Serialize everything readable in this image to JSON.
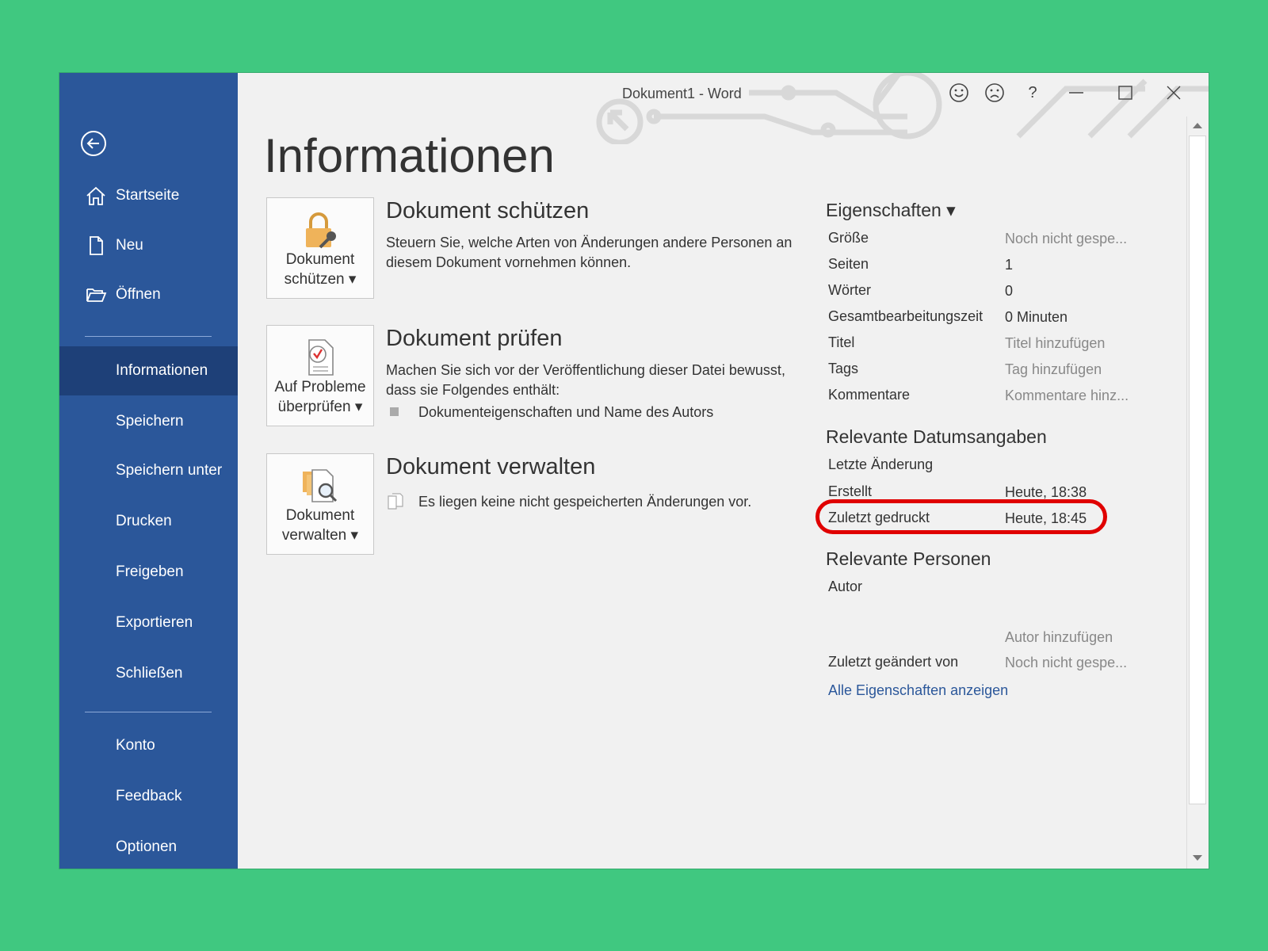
{
  "window": {
    "title": "Dokument1  -  Word",
    "help": "?"
  },
  "sidebar": {
    "items": [
      {
        "label": "Startseite"
      },
      {
        "label": "Neu"
      },
      {
        "label": "Öffnen"
      },
      {
        "label": "Informationen"
      },
      {
        "label": "Speichern"
      },
      {
        "label": "Speichern unter"
      },
      {
        "label": "Drucken"
      },
      {
        "label": "Freigeben"
      },
      {
        "label": "Exportieren"
      },
      {
        "label": "Schließen"
      },
      {
        "label": "Konto"
      },
      {
        "label": "Feedback"
      },
      {
        "label": "Optionen"
      }
    ],
    "active": "Informationen"
  },
  "main": {
    "title": "Informationen",
    "sections": [
      {
        "button": "Dokument\nschützen ▾",
        "title": "Dokument schützen",
        "text": "Steuern Sie, welche Arten von Änderungen andere Personen an diesem Dokument vornehmen können."
      },
      {
        "button": "Auf Probleme\nüberprüfen ▾",
        "title": "Dokument prüfen",
        "text": "Machen Sie sich vor der Veröffentlichung dieser Datei bewusst, dass sie Folgendes enthält:",
        "bullet": "Dokumenteigenschaften und Name des Autors"
      },
      {
        "button": "Dokument\nverwalten ▾",
        "title": "Dokument verwalten",
        "text": "Es liegen keine nicht gespeicherten Änderungen vor."
      }
    ]
  },
  "properties": {
    "header": "Eigenschaften ▾",
    "rows": [
      {
        "label": "Größe",
        "value": "Noch nicht gespe..."
      },
      {
        "label": "Seiten",
        "value": "1"
      },
      {
        "label": "Wörter",
        "value": "0"
      },
      {
        "label": "Gesamtbearbeitungszeit",
        "value": "0 Minuten"
      },
      {
        "label": "Titel",
        "value": "Titel hinzufügen"
      },
      {
        "label": "Tags",
        "value": "Tag hinzufügen"
      },
      {
        "label": "Kommentare",
        "value": "Kommentare hinz..."
      }
    ],
    "dates_header": "Relevante Datumsangaben",
    "dates": [
      {
        "label": "Letzte Änderung",
        "value": ""
      },
      {
        "label": "Erstellt",
        "value": "Heute, 18:38"
      },
      {
        "label": "Zuletzt gedruckt",
        "value": "Heute, 18:45"
      }
    ],
    "people_header": "Relevante Personen",
    "author_label": "Autor",
    "add_author": "Autor hinzufügen",
    "last_modified_by_label": "Zuletzt geändert von",
    "last_modified_by_value": "Noch nicht gespe...",
    "show_all_link": "Alle Eigenschaften anzeigen"
  },
  "colors": {
    "background": "#40c880",
    "sidebar": "#2b579a",
    "sidebar_active": "#1e4078",
    "highlight": "#e00000",
    "link": "#2b579a"
  }
}
